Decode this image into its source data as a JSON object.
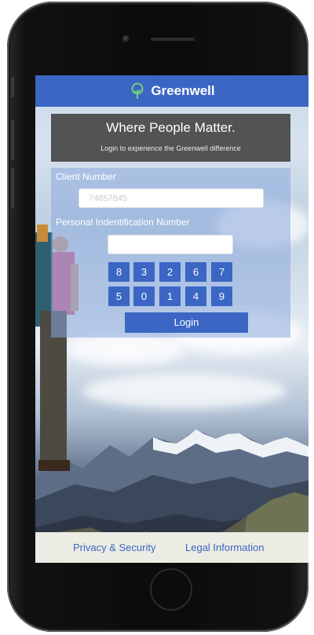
{
  "app": {
    "brand": "Greenwell"
  },
  "banner": {
    "headline": "Where People Matter.",
    "subtitle": "Login to experience the Greenwell difference"
  },
  "login": {
    "client_label": "Client Number",
    "client_value": "74857845",
    "pin_label": "Personal Indentification Number",
    "pin_value": "",
    "keypad_row1": [
      "8",
      "3",
      "2",
      "6",
      "7"
    ],
    "keypad_row2": [
      "5",
      "0",
      "1",
      "4",
      "9"
    ],
    "login_label": "Login"
  },
  "footer": {
    "privacy_label": "Privacy & Security",
    "legal_label": "Legal Information"
  },
  "colors": {
    "accent": "#3b66c4",
    "banner_bg": "#464646",
    "footer_bg": "#ecebe4"
  }
}
